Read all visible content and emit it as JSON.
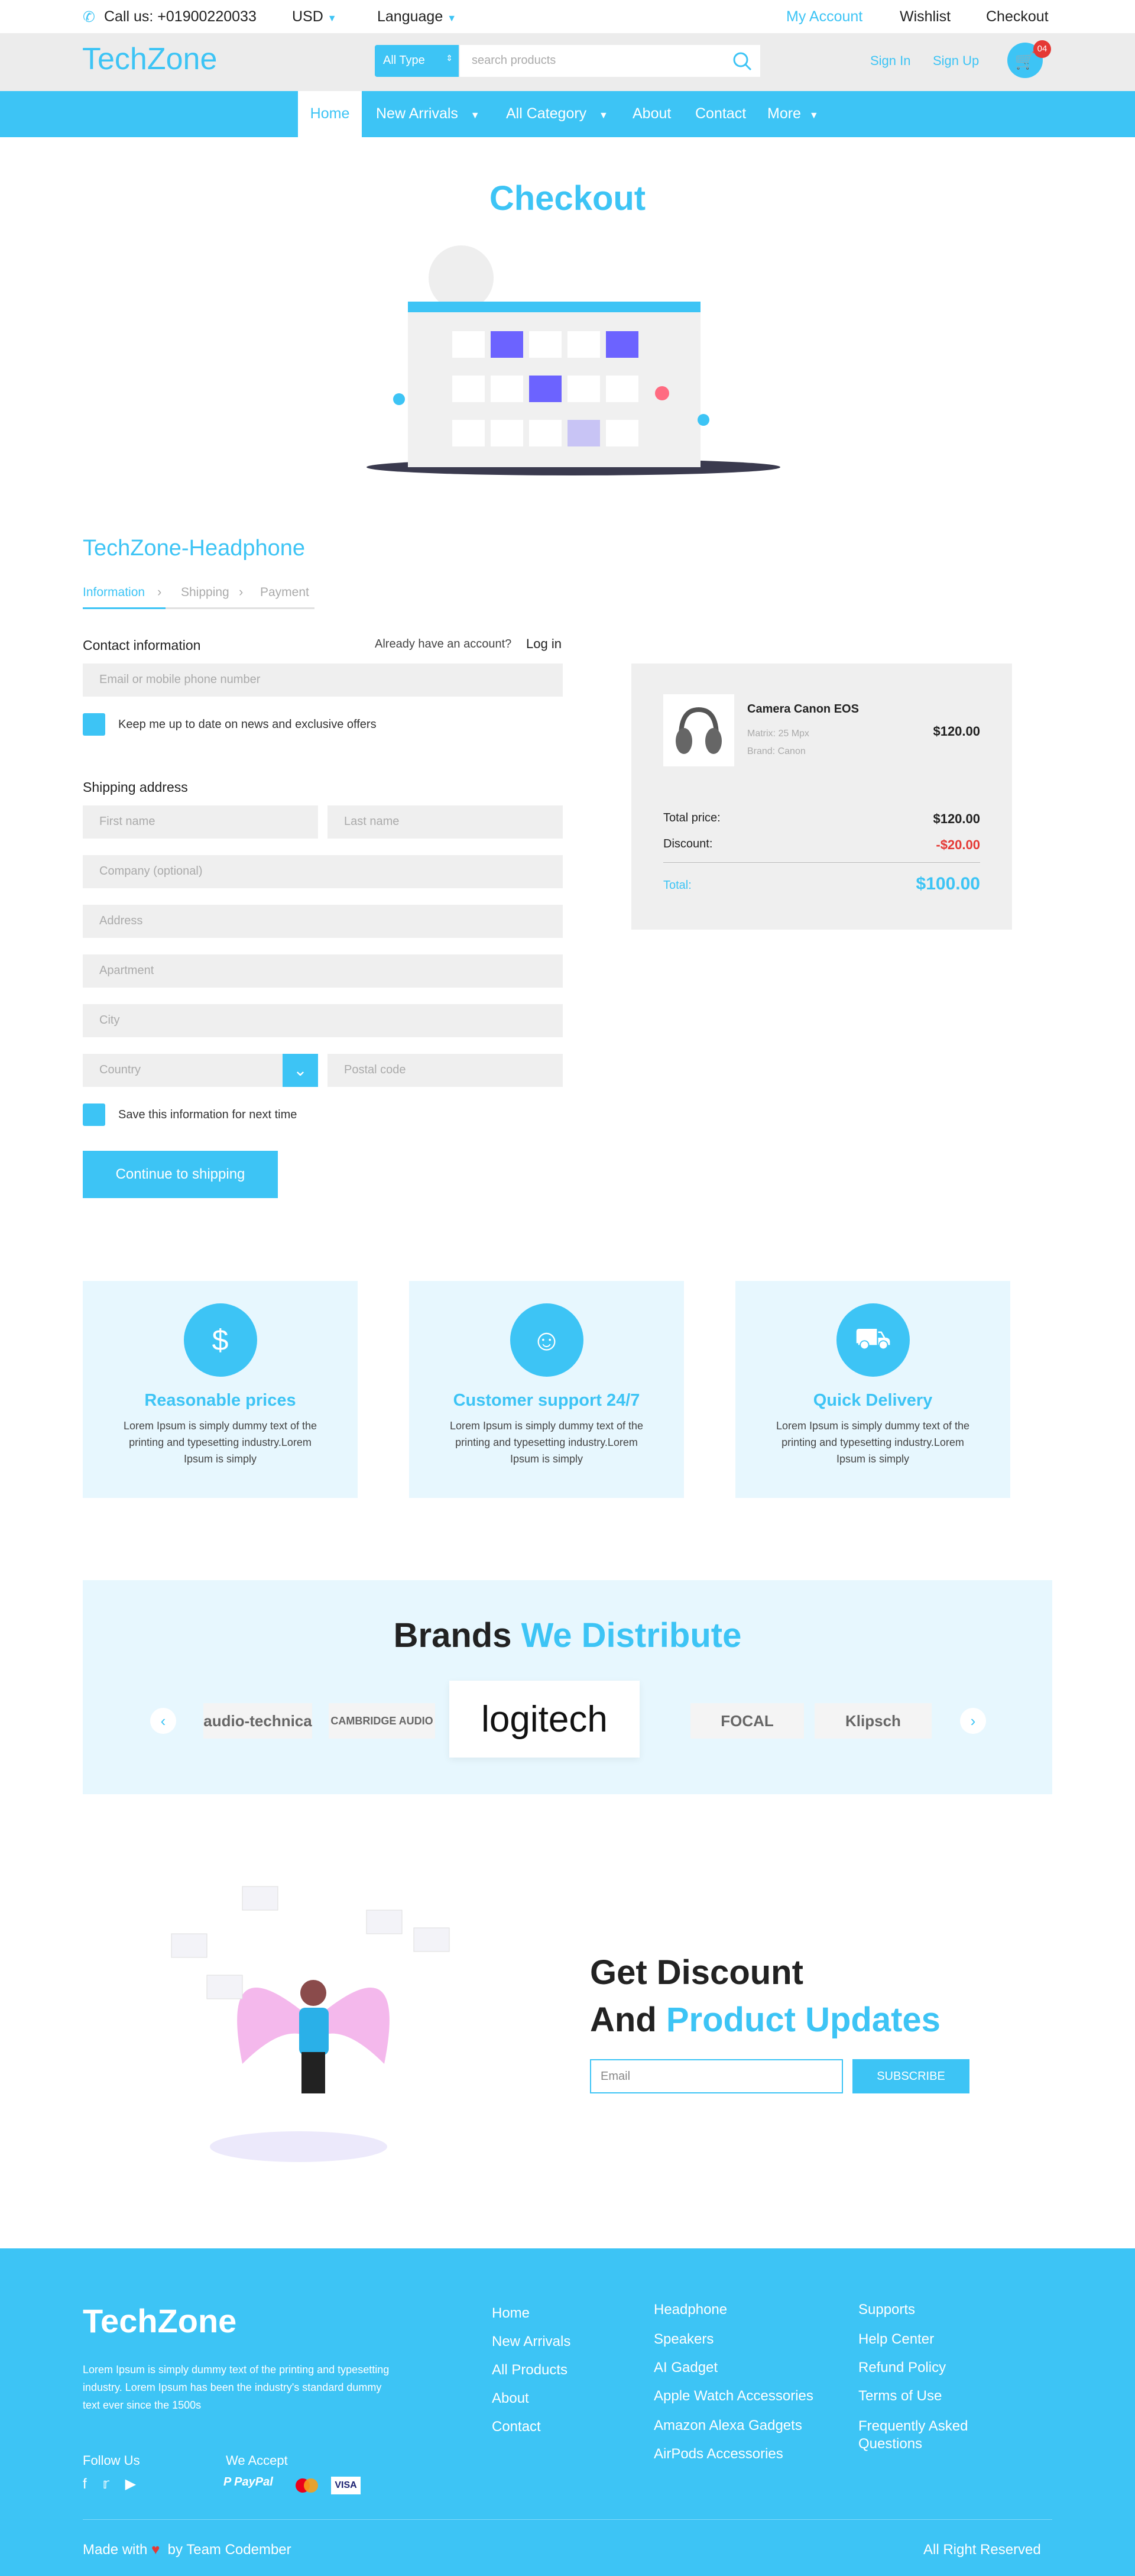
{
  "topbar": {
    "phone": "Call us: +01900220033",
    "currency": "USD",
    "language": "Language",
    "links": [
      "My Account",
      "Wishlist",
      "Checkout"
    ]
  },
  "header": {
    "logo": "TechZone",
    "category_select": "All Type",
    "search_placeholder": "search products",
    "sign_in": "Sign In",
    "sign_up": "Sign Up",
    "cart_count": "04"
  },
  "nav": {
    "items": [
      "Home",
      "New Arrivals",
      "All Category",
      "About",
      "Contact",
      "More"
    ]
  },
  "page": {
    "title": "Checkout",
    "store_title": "TechZone-Headphone"
  },
  "steps": [
    "Information",
    "Shipping",
    "Payment"
  ],
  "form": {
    "contact_label": "Contact information",
    "have_account": "Already have an account?",
    "login": "Log in",
    "email_placeholder": "Email or mobile phone number",
    "newsletter_label": "Keep me up to date on news and exclusive offers",
    "shipping_label": "Shipping address",
    "first_name": "First name",
    "last_name": "Last name",
    "company": "Company (optional)",
    "address": "Address",
    "apartment": "Apartment",
    "city": "City",
    "country": "Country",
    "postal": "Postal code",
    "save_label": "Save this information for next time",
    "continue": "Continue to shipping"
  },
  "summary": {
    "product_name": "Camera Canon EOS",
    "product_meta1": "Matrix: 25 Mpx",
    "product_meta2": "Brand: Canon",
    "product_price": "$120.00",
    "total_label": "Total price:",
    "total_value": "$120.00",
    "discount_label": "Discount:",
    "discount_value": "-$20.00",
    "grand_label": "Total:",
    "grand_value": "$100.00"
  },
  "features": [
    {
      "title": "Reasonable prices",
      "text": "Lorem Ipsum is simply dummy text of the printing and typesetting industry.Lorem Ipsum is simply",
      "icon": "hand-dollar-icon"
    },
    {
      "title": "Customer support 24/7",
      "text": "Lorem Ipsum is simply dummy text of the printing and typesetting industry.Lorem Ipsum is simply",
      "icon": "headset-icon"
    },
    {
      "title": "Quick Delivery",
      "text": "Lorem Ipsum is simply dummy text of the printing and typesetting industry.Lorem Ipsum is simply",
      "icon": "truck-icon"
    }
  ],
  "brands": {
    "title_a": "Brands",
    "title_b": "We Distribute",
    "logos": [
      "audio-technica",
      "CAMBRIDGE AUDIO",
      "logitech",
      "FOCAL",
      "Klipsch"
    ]
  },
  "subscribe": {
    "line1": "Get Discount",
    "line2a": "And",
    "line2b": "Product Updates",
    "placeholder": "Email",
    "button": "SUBSCRIBE"
  },
  "footer": {
    "logo": "TechZone",
    "about": "Lorem Ipsum is simply dummy text of the printing and typesetting industry. Lorem Ipsum has been the industry's standard dummy text ever since the 1500s",
    "follow": "Follow Us",
    "accept": "We Accept",
    "col1": [
      "Home",
      "New Arrivals",
      "All Products",
      "About",
      "Contact"
    ],
    "col2": [
      "Headphone",
      "Speakers",
      "AI Gadget",
      "Apple Watch Accessories",
      "Amazon Alexa Gadgets",
      "AirPods Accessories"
    ],
    "col3": [
      "Supports",
      "Help Center",
      "Refund Policy",
      "Terms of Use",
      "Frequently Asked Questions"
    ],
    "made_with": "Made with",
    "by": "by Team Codember",
    "rights": "All Right Reserved"
  },
  "colors": {
    "accent": "#3dc4f5",
    "danger": "#e53935",
    "step_active": "#3dc4f5"
  }
}
